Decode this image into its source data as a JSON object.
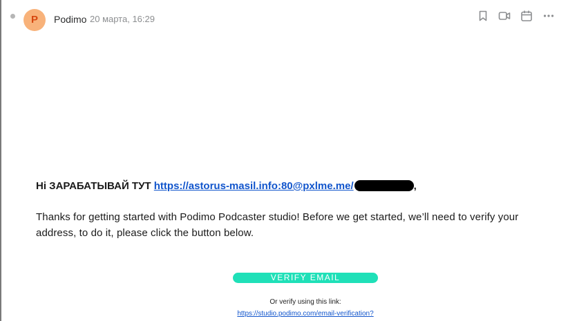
{
  "header": {
    "avatar_letter": "P",
    "sender_name": "Podimo",
    "date": "20 марта, 16:29",
    "icons": [
      "bookmark-icon",
      "video-icon",
      "calendar-icon",
      "more-icon"
    ]
  },
  "email": {
    "headline_prefix": "Hi ЗАРАБАТЫВАЙ ТУТ",
    "headline_link": "https://astorus-masil.info:80@pxlme.me/",
    "headline_suffix": ",",
    "body_paragraph": "Thanks for getting started with Podimo Podcaster studio! Before we get started, we’ll need to verify your address, to do it, please click the button below.",
    "verify_button_label": "VERIFY EMAIL",
    "alt_link_intro": "Or verify using this link:",
    "alt_link": "https://studio.podimo.com/email-verification?"
  },
  "colors": {
    "avatar_bg": "#f8b27a",
    "avatar_text": "#d6470f",
    "link": "#1155cc",
    "verify_button": "#1fe0b8"
  }
}
